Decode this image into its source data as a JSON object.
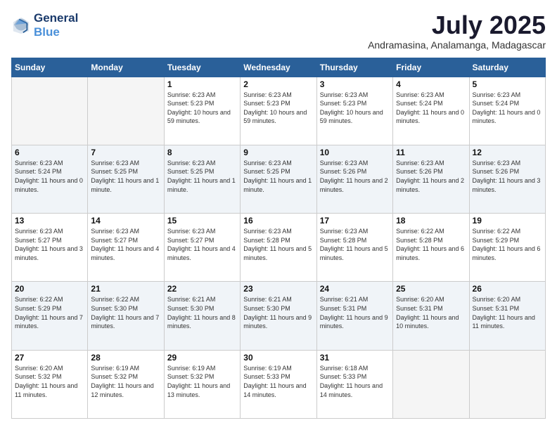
{
  "header": {
    "logo_line1": "General",
    "logo_line2": "Blue",
    "month": "July 2025",
    "location": "Andramasina, Analamanga, Madagascar"
  },
  "days_of_week": [
    "Sunday",
    "Monday",
    "Tuesday",
    "Wednesday",
    "Thursday",
    "Friday",
    "Saturday"
  ],
  "weeks": [
    [
      {
        "day": "",
        "info": ""
      },
      {
        "day": "",
        "info": ""
      },
      {
        "day": "1",
        "info": "Sunrise: 6:23 AM\nSunset: 5:23 PM\nDaylight: 10 hours and 59 minutes."
      },
      {
        "day": "2",
        "info": "Sunrise: 6:23 AM\nSunset: 5:23 PM\nDaylight: 10 hours and 59 minutes."
      },
      {
        "day": "3",
        "info": "Sunrise: 6:23 AM\nSunset: 5:23 PM\nDaylight: 10 hours and 59 minutes."
      },
      {
        "day": "4",
        "info": "Sunrise: 6:23 AM\nSunset: 5:24 PM\nDaylight: 11 hours and 0 minutes."
      },
      {
        "day": "5",
        "info": "Sunrise: 6:23 AM\nSunset: 5:24 PM\nDaylight: 11 hours and 0 minutes."
      }
    ],
    [
      {
        "day": "6",
        "info": "Sunrise: 6:23 AM\nSunset: 5:24 PM\nDaylight: 11 hours and 0 minutes."
      },
      {
        "day": "7",
        "info": "Sunrise: 6:23 AM\nSunset: 5:25 PM\nDaylight: 11 hours and 1 minute."
      },
      {
        "day": "8",
        "info": "Sunrise: 6:23 AM\nSunset: 5:25 PM\nDaylight: 11 hours and 1 minute."
      },
      {
        "day": "9",
        "info": "Sunrise: 6:23 AM\nSunset: 5:25 PM\nDaylight: 11 hours and 1 minute."
      },
      {
        "day": "10",
        "info": "Sunrise: 6:23 AM\nSunset: 5:26 PM\nDaylight: 11 hours and 2 minutes."
      },
      {
        "day": "11",
        "info": "Sunrise: 6:23 AM\nSunset: 5:26 PM\nDaylight: 11 hours and 2 minutes."
      },
      {
        "day": "12",
        "info": "Sunrise: 6:23 AM\nSunset: 5:26 PM\nDaylight: 11 hours and 3 minutes."
      }
    ],
    [
      {
        "day": "13",
        "info": "Sunrise: 6:23 AM\nSunset: 5:27 PM\nDaylight: 11 hours and 3 minutes."
      },
      {
        "day": "14",
        "info": "Sunrise: 6:23 AM\nSunset: 5:27 PM\nDaylight: 11 hours and 4 minutes."
      },
      {
        "day": "15",
        "info": "Sunrise: 6:23 AM\nSunset: 5:27 PM\nDaylight: 11 hours and 4 minutes."
      },
      {
        "day": "16",
        "info": "Sunrise: 6:23 AM\nSunset: 5:28 PM\nDaylight: 11 hours and 5 minutes."
      },
      {
        "day": "17",
        "info": "Sunrise: 6:23 AM\nSunset: 5:28 PM\nDaylight: 11 hours and 5 minutes."
      },
      {
        "day": "18",
        "info": "Sunrise: 6:22 AM\nSunset: 5:28 PM\nDaylight: 11 hours and 6 minutes."
      },
      {
        "day": "19",
        "info": "Sunrise: 6:22 AM\nSunset: 5:29 PM\nDaylight: 11 hours and 6 minutes."
      }
    ],
    [
      {
        "day": "20",
        "info": "Sunrise: 6:22 AM\nSunset: 5:29 PM\nDaylight: 11 hours and 7 minutes."
      },
      {
        "day": "21",
        "info": "Sunrise: 6:22 AM\nSunset: 5:30 PM\nDaylight: 11 hours and 7 minutes."
      },
      {
        "day": "22",
        "info": "Sunrise: 6:21 AM\nSunset: 5:30 PM\nDaylight: 11 hours and 8 minutes."
      },
      {
        "day": "23",
        "info": "Sunrise: 6:21 AM\nSunset: 5:30 PM\nDaylight: 11 hours and 9 minutes."
      },
      {
        "day": "24",
        "info": "Sunrise: 6:21 AM\nSunset: 5:31 PM\nDaylight: 11 hours and 9 minutes."
      },
      {
        "day": "25",
        "info": "Sunrise: 6:20 AM\nSunset: 5:31 PM\nDaylight: 11 hours and 10 minutes."
      },
      {
        "day": "26",
        "info": "Sunrise: 6:20 AM\nSunset: 5:31 PM\nDaylight: 11 hours and 11 minutes."
      }
    ],
    [
      {
        "day": "27",
        "info": "Sunrise: 6:20 AM\nSunset: 5:32 PM\nDaylight: 11 hours and 11 minutes."
      },
      {
        "day": "28",
        "info": "Sunrise: 6:19 AM\nSunset: 5:32 PM\nDaylight: 11 hours and 12 minutes."
      },
      {
        "day": "29",
        "info": "Sunrise: 6:19 AM\nSunset: 5:32 PM\nDaylight: 11 hours and 13 minutes."
      },
      {
        "day": "30",
        "info": "Sunrise: 6:19 AM\nSunset: 5:33 PM\nDaylight: 11 hours and 14 minutes."
      },
      {
        "day": "31",
        "info": "Sunrise: 6:18 AM\nSunset: 5:33 PM\nDaylight: 11 hours and 14 minutes."
      },
      {
        "day": "",
        "info": ""
      },
      {
        "day": "",
        "info": ""
      }
    ]
  ]
}
